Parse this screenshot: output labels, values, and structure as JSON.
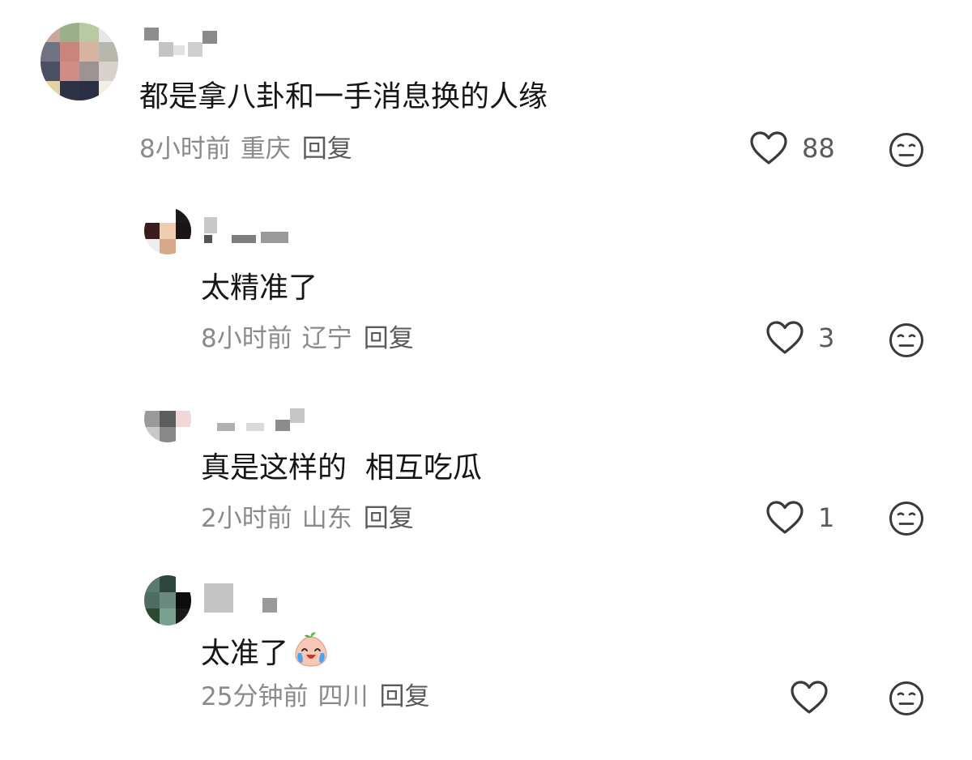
{
  "comments": [
    {
      "text": "都是拿八卦和一手消息换的人缘",
      "time": "8小时前",
      "location": "重庆",
      "reply_label": "回复",
      "likes": "88"
    },
    {
      "text": "太精准了",
      "time": "8小时前",
      "location": "辽宁",
      "reply_label": "回复",
      "likes": "3"
    },
    {
      "text": "真是这样的  相互吃瓜",
      "time": "2小时前",
      "location": "山东",
      "reply_label": "回复",
      "likes": "1"
    },
    {
      "text": "太准了",
      "emoji": "crying-laughing-peach-emoji",
      "time": "25分钟前",
      "location": "四川",
      "reply_label": "回复",
      "likes": ""
    }
  ],
  "colors": {
    "text": "#161616",
    "meta": "#8a8a8a",
    "reply": "#5a5a5a",
    "icon": "#3a3a3a"
  },
  "icons": {
    "like": "heart-outline-icon",
    "dislike": "neutral-face-icon"
  }
}
